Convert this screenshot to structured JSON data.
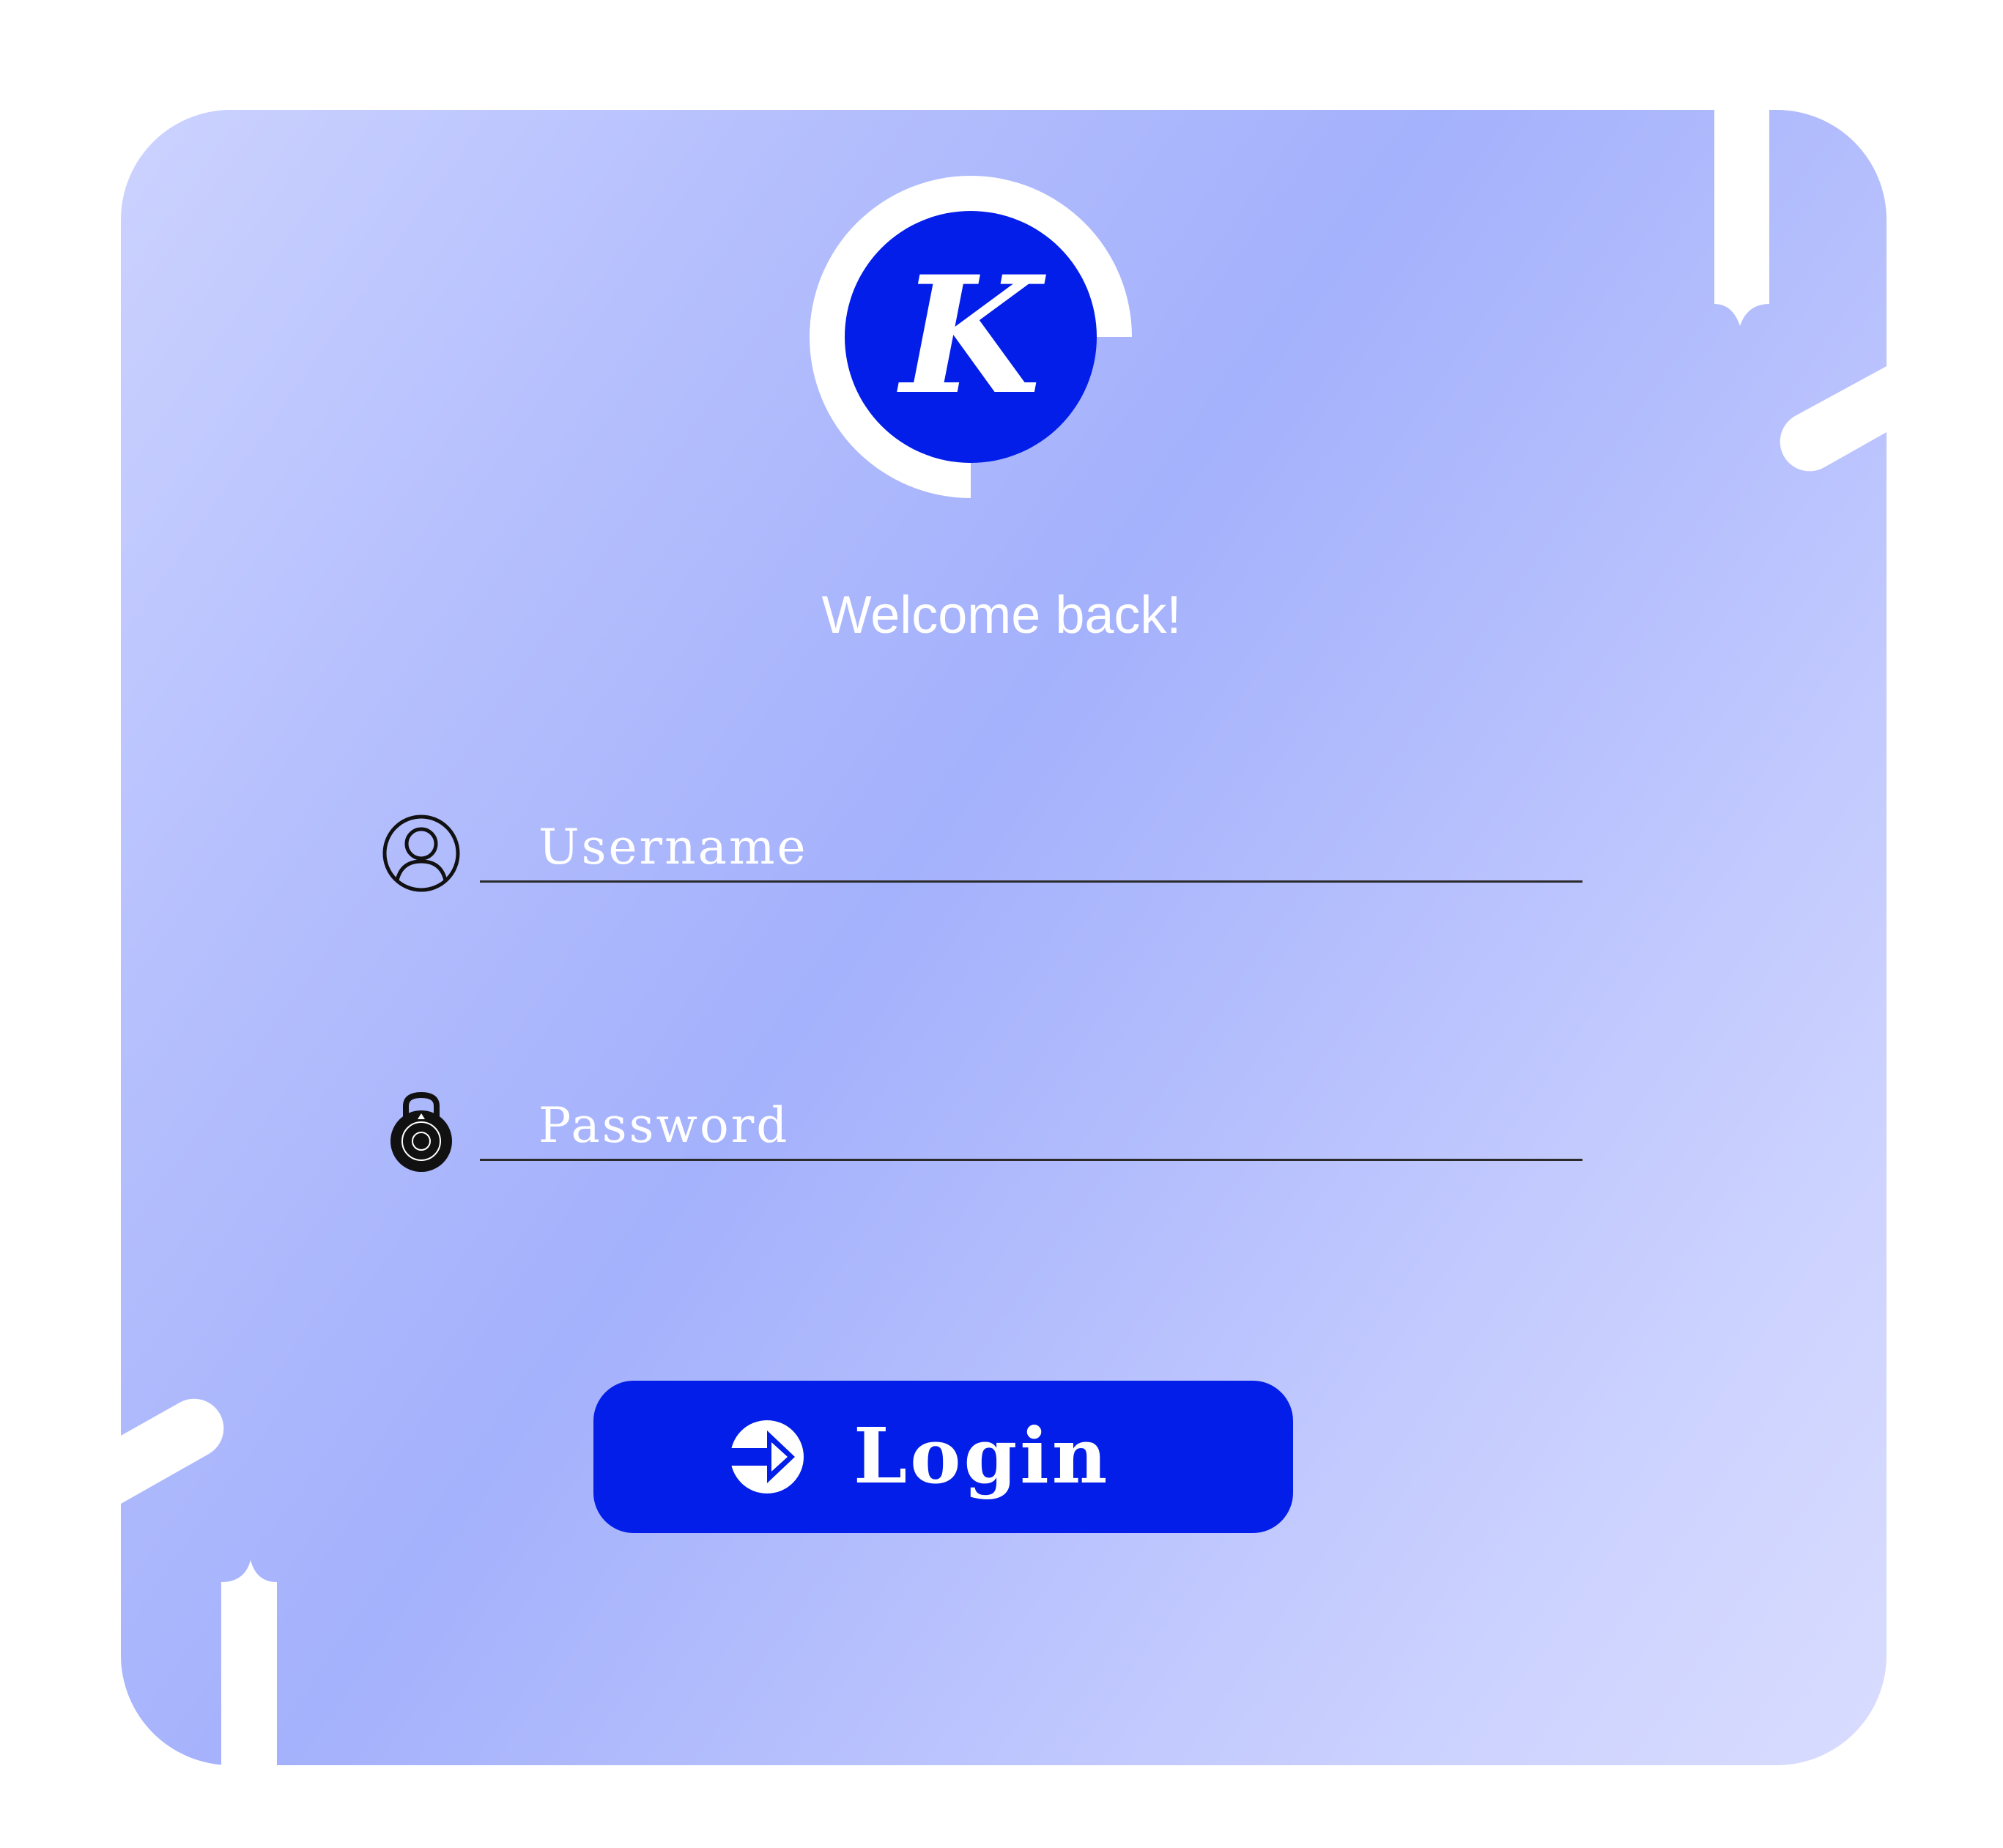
{
  "logo": {
    "letter": "K"
  },
  "welcome": {
    "text": "Welcome back!"
  },
  "username": {
    "placeholder": "Username",
    "value": ""
  },
  "password": {
    "placeholder": "Password",
    "value": ""
  },
  "login": {
    "label": "Login"
  },
  "icons": {
    "username": "user-circle-icon",
    "password": "combination-lock-icon",
    "login": "arrow-right-circle-icon"
  },
  "colors": {
    "accent": "#021ee8",
    "card_gradient_light": "#ccd3ff",
    "card_gradient_mid": "#a4b1fc",
    "text": "#ffffff"
  }
}
